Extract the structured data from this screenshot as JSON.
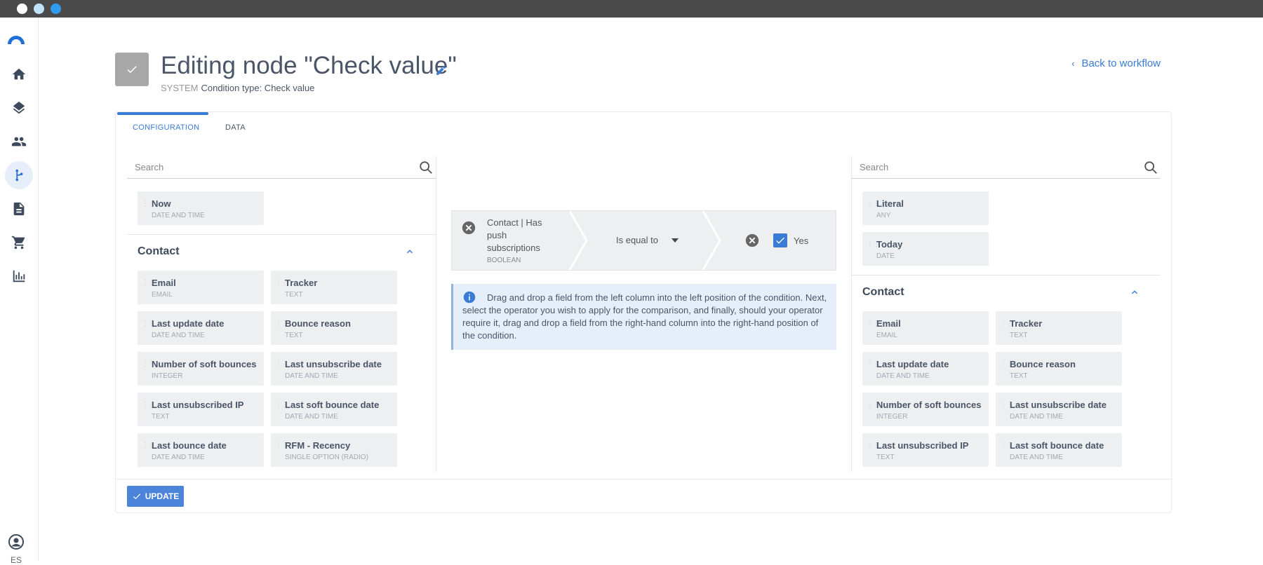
{
  "header": {
    "title": "Editing node \"Check value\"",
    "system_label": "SYSTEM",
    "condition_type": "Condition type: Check value",
    "back_link": "Back to workflow"
  },
  "tabs": [
    {
      "label": "CONFIGURATION"
    },
    {
      "label": "DATA"
    }
  ],
  "left_column": {
    "search_placeholder": "Search",
    "general_fields": [
      {
        "name": "Now",
        "type": "DATE AND TIME"
      }
    ],
    "section_title": "Contact",
    "fields": [
      {
        "name": "Email",
        "type": "EMAIL"
      },
      {
        "name": "Tracker",
        "type": "TEXT"
      },
      {
        "name": "Last update date",
        "type": "DATE AND TIME"
      },
      {
        "name": "Bounce reason",
        "type": "TEXT"
      },
      {
        "name": "Number of soft bounces",
        "type": "INTEGER"
      },
      {
        "name": "Last unsubscribe date",
        "type": "DATE AND TIME"
      },
      {
        "name": "Last unsubscribed IP",
        "type": "TEXT"
      },
      {
        "name": "Last soft bounce date",
        "type": "DATE AND TIME"
      },
      {
        "name": "Last bounce date",
        "type": "DATE AND TIME"
      },
      {
        "name": "RFM - Recency",
        "type": "SINGLE OPTION (RADIO)"
      }
    ]
  },
  "condition": {
    "left_field": "Contact | Has push subscriptions",
    "left_type": "BOOLEAN",
    "operator": "Is equal to",
    "right_value": "Yes"
  },
  "info": {
    "text": "Drag and drop a field from the left column into the left position of the condition. Next, select the operator you wish to apply for the comparison, and finally, should your operator require it, drag and drop a field from the right-hand column into the right-hand position of the condition."
  },
  "right_column": {
    "search_placeholder": "Search",
    "general_fields": [
      {
        "name": "Literal",
        "type": "ANY"
      },
      {
        "name": "Today",
        "type": "DATE"
      }
    ],
    "section_title": "Contact",
    "fields": [
      {
        "name": "Email",
        "type": "EMAIL"
      },
      {
        "name": "Tracker",
        "type": "TEXT"
      },
      {
        "name": "Last update date",
        "type": "DATE AND TIME"
      },
      {
        "name": "Bounce reason",
        "type": "TEXT"
      },
      {
        "name": "Number of soft bounces",
        "type": "INTEGER"
      },
      {
        "name": "Last unsubscribe date",
        "type": "DATE AND TIME"
      },
      {
        "name": "Last unsubscribed IP",
        "type": "TEXT"
      },
      {
        "name": "Last soft bounce date",
        "type": "DATE AND TIME"
      }
    ]
  },
  "footer": {
    "update_label": "UPDATE"
  },
  "user": {
    "locale": "ES"
  },
  "colors": {
    "accent": "#3a7bd5",
    "titlebar": "#4a4a4a",
    "field_bg": "#eeeff1",
    "info_bg": "#e6eef9"
  },
  "icons": {
    "sidebar": [
      "logo-icon",
      "home-icon",
      "layers-icon",
      "contacts-icon",
      "workflow-icon",
      "document-icon",
      "cart-icon",
      "chart-icon",
      "user-icon"
    ]
  }
}
